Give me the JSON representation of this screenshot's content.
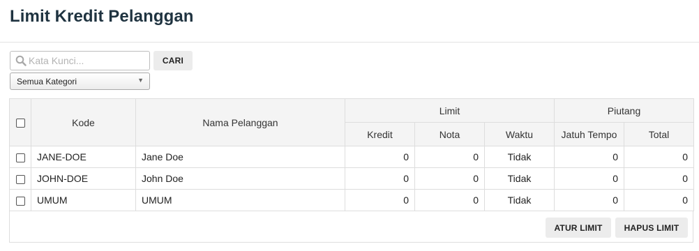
{
  "page": {
    "title": "Limit Kredit Pelanggan"
  },
  "search": {
    "placeholder": "Kata Kunci...",
    "button_label": "CARI",
    "icon": "search-icon"
  },
  "category_select": {
    "selected": "Semua Kategori"
  },
  "table": {
    "headers": {
      "kode": "Kode",
      "nama": "Nama Pelanggan",
      "limit_group": "Limit",
      "piutang_group": "Piutang",
      "kredit": "Kredit",
      "nota": "Nota",
      "waktu": "Waktu",
      "jatuh_tempo": "Jatuh Tempo",
      "total": "Total"
    },
    "rows": [
      {
        "kode": "JANE-DOE",
        "nama": "Jane Doe",
        "kredit": "0",
        "nota": "0",
        "waktu": "Tidak",
        "jatuh_tempo": "0",
        "total": "0"
      },
      {
        "kode": "JOHN-DOE",
        "nama": "John Doe",
        "kredit": "0",
        "nota": "0",
        "waktu": "Tidak",
        "jatuh_tempo": "0",
        "total": "0"
      },
      {
        "kode": "UMUM",
        "nama": "UMUM",
        "kredit": "0",
        "nota": "0",
        "waktu": "Tidak",
        "jatuh_tempo": "0",
        "total": "0"
      }
    ]
  },
  "actions": {
    "atur_limit": "ATUR LIMIT",
    "hapus_limit": "HAPUS LIMIT"
  }
}
